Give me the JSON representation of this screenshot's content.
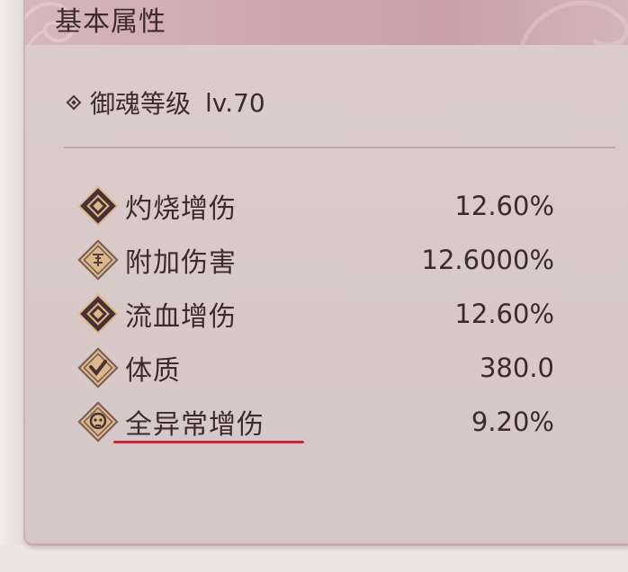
{
  "panel": {
    "title": "基本属性"
  },
  "soul_level": {
    "label": "御魂等级",
    "value": "lv.70"
  },
  "stats": [
    {
      "name": "灼烧增伤",
      "value": "12.60%",
      "icon": "diamond-icon"
    },
    {
      "name": "附加伤害",
      "value": "12.6000%",
      "icon": "rune-diamond-icon"
    },
    {
      "name": "流血增伤",
      "value": "12.60%",
      "icon": "diamond-icon"
    },
    {
      "name": "体质",
      "value": "380.0",
      "icon": "shield-check-icon"
    },
    {
      "name": "全异常增伤",
      "value": "9.20%",
      "icon": "skull-diamond-icon"
    }
  ],
  "colors": {
    "panel_bg": "#d8c9c8",
    "header_bg": "#cfa9ae",
    "text": "#3d2a2c",
    "icon_dark": "#4a2f33",
    "icon_gold": "#d9b98a",
    "underline": "#b53140"
  }
}
